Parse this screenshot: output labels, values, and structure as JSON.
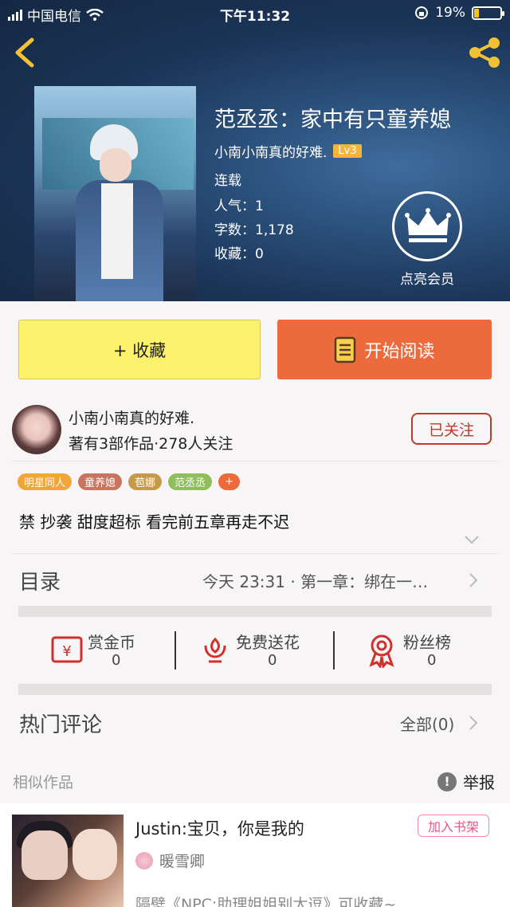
{
  "status_bar": {
    "carrier": "中国电信",
    "time": "下午11:32",
    "battery_percent": "19%",
    "battery_level": 0.19
  },
  "book": {
    "title": "范丞丞：家中有只童养媳",
    "author": "小南小南真的好难.",
    "level": "Lv3",
    "status": "连载",
    "popularity": "人气：1",
    "word_count": "字数：1,178",
    "favorites": "收藏：0"
  },
  "vip": {
    "label": "点亮会员"
  },
  "buttons": {
    "collect": "+ 收藏",
    "read": "开始阅读"
  },
  "author_card": {
    "name": "小南小南真的好难.",
    "stats": "著有3部作品·278人关注",
    "follow": "已关注"
  },
  "tags": [
    {
      "label": "明星同人",
      "color": "#f0a63a"
    },
    {
      "label": "童养媳",
      "color": "#c9745f"
    },
    {
      "label": "苞娜",
      "color": "#c59a4a"
    },
    {
      "label": "范丞丞",
      "color": "#8fbf5a"
    },
    {
      "label": "+",
      "color": "#ec6a3b"
    }
  ],
  "description": "禁 抄袭 甜度超标 看完前五章再走不迟",
  "toc": {
    "title": "目录",
    "latest": "今天 23:31 · 第一章：绑在一…"
  },
  "actions": [
    {
      "label": "赏金币",
      "count": "0",
      "icon": "gold-coin-icon"
    },
    {
      "label": "免费送花",
      "count": "0",
      "icon": "flower-icon"
    },
    {
      "label": "粉丝榜",
      "count": "0",
      "icon": "medal-icon"
    }
  ],
  "comments": {
    "title": "热门评论",
    "all": "全部(0)"
  },
  "similar": {
    "heading": "相似作品",
    "report": "举报",
    "item": {
      "title": "Justin:宝贝，你是我的",
      "add_shelf": "加入书架",
      "author": "暖雪卿",
      "desc": "隔壁《NPC:助理姐姐别太逗》可收藏~"
    }
  },
  "colors": {
    "accent_orange": "#ec6a3b",
    "collect_yellow": "#fdf26c",
    "follow_red": "#c0392b",
    "icon_red": "#d0312d"
  }
}
